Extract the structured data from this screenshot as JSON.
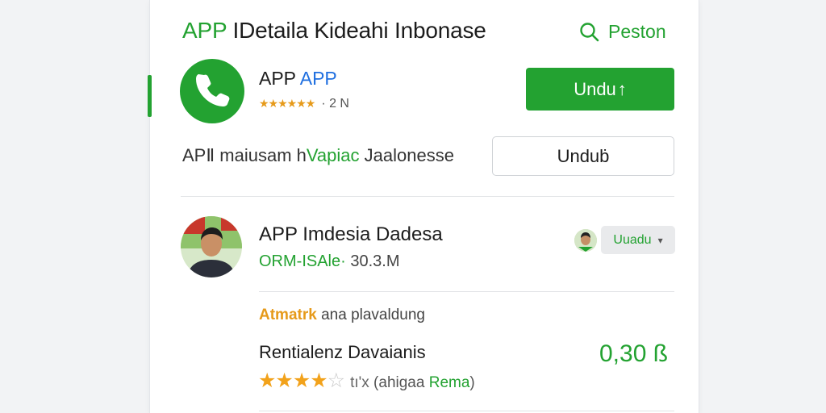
{
  "header": {
    "title_green": "APP",
    "title_rest": " IDetaila Kideahi Inbonase",
    "search_label": "Peston"
  },
  "app": {
    "name_part1": "APP ",
    "name_part2": "APP",
    "rating_stars": "★★★★★★",
    "rating_meta": "· 2 N",
    "install_button": "Undu",
    "install_arrow": "↑",
    "description_part1": "APⅡ maiusam h",
    "description_part2": "Vapiac",
    "description_part3": " Jaalonesse",
    "secondary_button": "Unduḃ"
  },
  "developer": {
    "name": "APP Imdesia Dadesa",
    "meta_label": "ORM-ISAle·",
    "meta_size": " 30.3.M",
    "dropdown_label": "Uuadu",
    "dropdown_caret": "▾"
  },
  "review": {
    "stars_label": "Atmatrk",
    "stars_text": " ana plavaldung",
    "title": "Rentialenz Davaianis",
    "price": "0,30 ß",
    "stars_filled": "★★★★",
    "stars_empty": "☆",
    "count": "tı'x",
    "paren_open": " (ahigaa ",
    "paren_highlight": "Rema",
    "paren_close": ")"
  },
  "colors": {
    "accent_green": "#23a231",
    "star_orange": "#f2a21b",
    "link_blue": "#1f6fe0"
  },
  "icons": {
    "search": "search-icon",
    "app": "phone-icon",
    "download": "arrow-up-icon",
    "dropdown": "chevron-down-icon"
  }
}
